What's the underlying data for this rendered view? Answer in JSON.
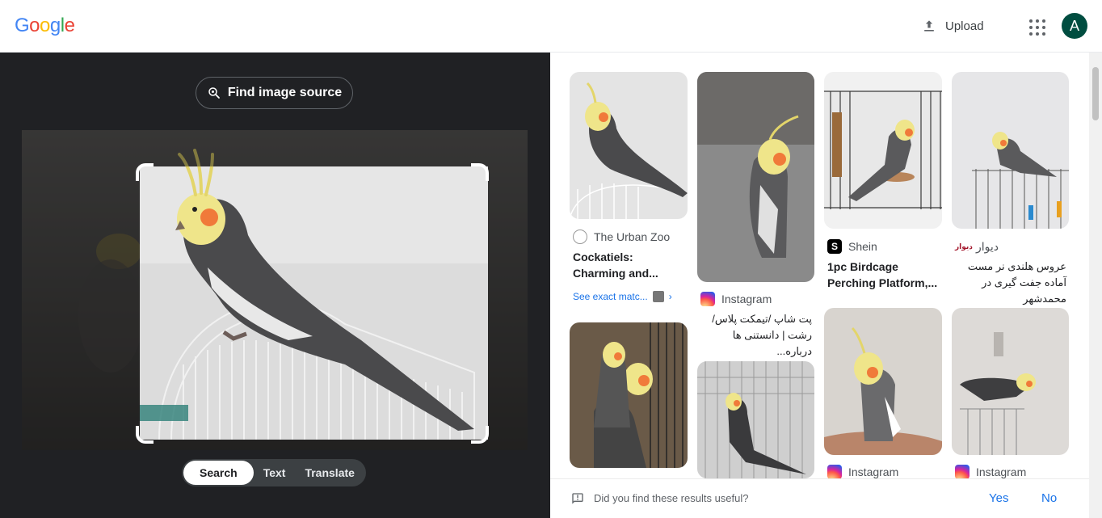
{
  "header": {
    "logo_letters": [
      {
        "char": "G",
        "color": "#4285F4"
      },
      {
        "char": "o",
        "color": "#EA4335"
      },
      {
        "char": "o",
        "color": "#FBBC05"
      },
      {
        "char": "g",
        "color": "#4285F4"
      },
      {
        "char": "l",
        "color": "#34A853"
      },
      {
        "char": "e",
        "color": "#EA4335"
      }
    ],
    "upload_label": "Upload",
    "avatar_letter": "A",
    "avatar_color": "#004d40"
  },
  "left": {
    "find_source_label": "Find image source",
    "tabs": [
      {
        "label": "Search",
        "active": true
      },
      {
        "label": "Text",
        "active": false
      },
      {
        "label": "Translate",
        "active": false
      }
    ]
  },
  "results": [
    {
      "source": "The Urban Zoo",
      "icon": "urban-zoo-icon",
      "title": "Cockatiels: Charming and...",
      "exact_match": "See exact matc..."
    },
    {
      "source": "Instagram",
      "icon": "instagram-icon",
      "title": "پت شاپ /تیمکت پلاس/ رشت | دانستنی ها درباره..."
    },
    {
      "source": "Shein",
      "icon": "shein-icon",
      "title": "1pc Birdcage Perching Platform,..."
    },
    {
      "source": "دیوار",
      "icon": "divar-icon",
      "title": "عروس هلندی نر مست آماده جفت گیری در محمدشهر"
    },
    {
      "source": "Instagram",
      "icon": "instagram-icon"
    },
    {
      "source": "Instagram",
      "icon": "instagram-icon"
    }
  ],
  "feedback": {
    "question": "Did you find these results useful?",
    "yes": "Yes",
    "no": "No"
  }
}
